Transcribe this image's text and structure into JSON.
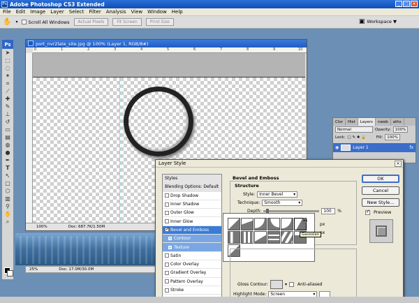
{
  "app": {
    "title": "Adobe Photoshop CS3 Extended",
    "logo": "Ps",
    "window_buttons": [
      "_",
      "□",
      "×"
    ]
  },
  "menu": [
    "File",
    "Edit",
    "Image",
    "Layer",
    "Select",
    "Filter",
    "Analysis",
    "View",
    "Window",
    "Help"
  ],
  "options_bar": {
    "scroll_all_windows": "Scroll All Windows",
    "actual_pixels": "Actual Pixels",
    "fit_screen": "Fit Screen",
    "print_size": "Print Size",
    "workspace": "Workspace ▼"
  },
  "document": {
    "title": "port_nvr2late_site.jpg @ 100% (Layer 1, RGB/8#)",
    "ruler_numbers": [
      "0",
      "1",
      "2",
      "3",
      "4",
      "5",
      "6",
      "7",
      "8",
      "9",
      "10"
    ],
    "zoom": "100%",
    "doc_info": "Doc: 687.7K/1.50M"
  },
  "document2": {
    "zoom": "25%",
    "doc_info": "Doc: 17.0M/30.0M"
  },
  "layers_panel": {
    "tabs": [
      "Clor",
      "Hist",
      "Layers",
      "nweb",
      "aths"
    ],
    "active_tab": "Layers",
    "blend_mode": "Normal",
    "opacity_label": "Opacity:",
    "opacity_value": "100%",
    "lock_label": "Lock:",
    "fill_label": "Fill:",
    "fill_value": "100%",
    "layer_name": "Layer 1",
    "fx": "fx"
  },
  "layer_style": {
    "title": "Layer Style",
    "styles_list": [
      {
        "label": "Styles",
        "type": "header"
      },
      {
        "label": "Blending Options: Default",
        "type": "header"
      },
      {
        "label": "Drop Shadow",
        "checked": false
      },
      {
        "label": "Inner Shadow",
        "checked": false
      },
      {
        "label": "Outer Glow",
        "checked": false
      },
      {
        "label": "Inner Glow",
        "checked": false
      },
      {
        "label": "Bevel and Emboss",
        "checked": true,
        "selected": true
      },
      {
        "label": "Contour",
        "type": "sub"
      },
      {
        "label": "Texture",
        "type": "sub"
      },
      {
        "label": "Satin",
        "checked": false
      },
      {
        "label": "Color Overlay",
        "checked": false
      },
      {
        "label": "Gradient Overlay",
        "checked": false
      },
      {
        "label": "Pattern Overlay",
        "checked": false
      },
      {
        "label": "Stroke",
        "checked": false
      }
    ],
    "panel_title": "Bevel and Emboss",
    "structure_title": "Structure",
    "style_label": "Style:",
    "style_value": "Inner Bevel",
    "technique_label": "Technique:",
    "technique_value": "Smooth",
    "depth_label": "Depth:",
    "depth_value": "100",
    "percent": "%",
    "px": "px",
    "contour_tooltip": "Gaussian",
    "gloss_contour_label": "Gloss Contour:",
    "anti_aliased_label": "Anti-aliased",
    "highlight_mode_label": "Highlight Mode:",
    "highlight_mode_value": "Screen",
    "buttons": {
      "ok": "OK",
      "cancel": "Cancel",
      "new_style": "New Style...",
      "preview": "Preview"
    },
    "preview_checked": true
  }
}
